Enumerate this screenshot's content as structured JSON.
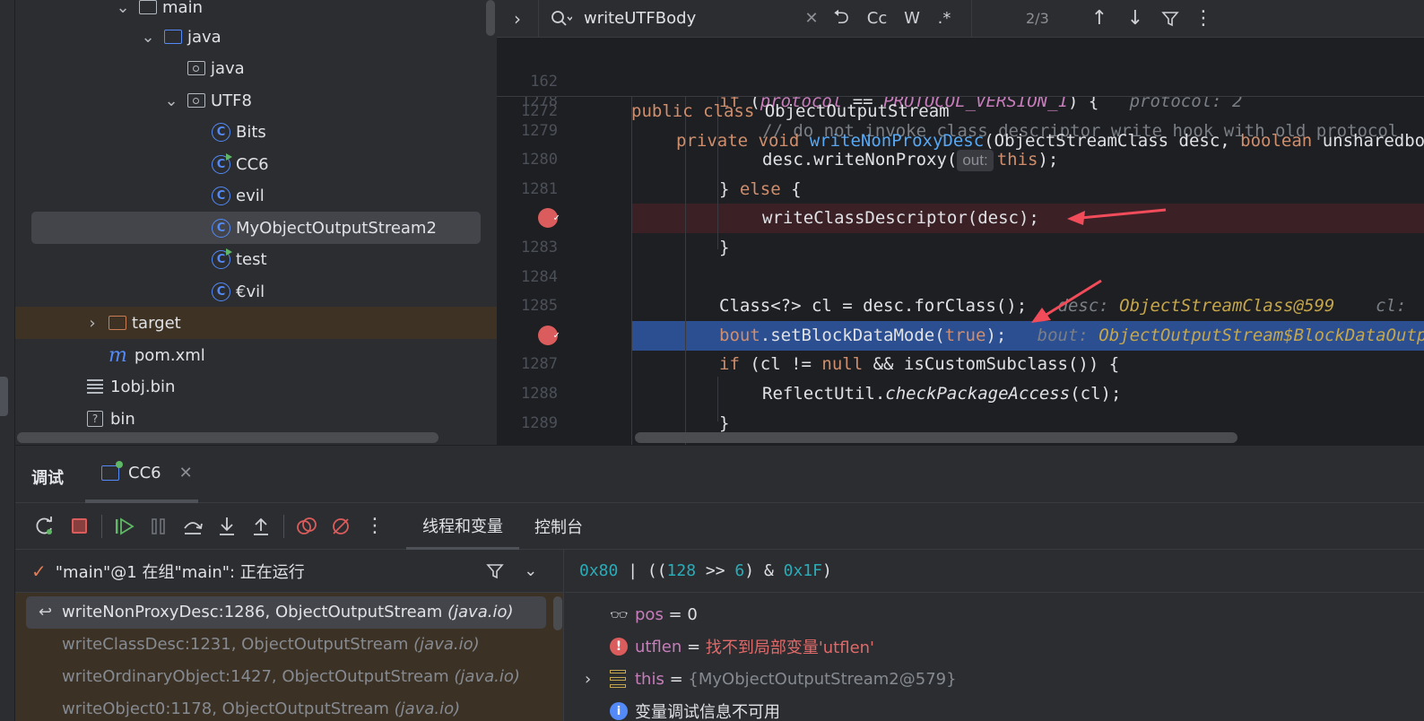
{
  "project_tree": {
    "items": [
      {
        "label": "main",
        "depth": 6,
        "expanded": true,
        "icon": "folder-icon"
      },
      {
        "label": "java",
        "depth": 7,
        "expanded": true,
        "icon": "source-folder-icon"
      },
      {
        "label": "java",
        "depth": 8,
        "icon": "package-icon"
      },
      {
        "label": "UTF8",
        "depth": 8,
        "expanded": true,
        "icon": "package-icon"
      },
      {
        "label": "Bits",
        "depth": 9,
        "icon": "class-icon"
      },
      {
        "label": "CC6",
        "depth": 9,
        "icon": "runnable-class-icon"
      },
      {
        "label": "evil",
        "depth": 9,
        "icon": "class-icon"
      },
      {
        "label": "MyObjectOutputStream2",
        "depth": 9,
        "icon": "class-icon",
        "selected": true
      },
      {
        "label": "test",
        "depth": 9,
        "icon": "runnable-class-icon"
      },
      {
        "label": "€vil",
        "depth": 9,
        "icon": "class-icon"
      },
      {
        "label": "target",
        "depth": 5,
        "expanded": false,
        "icon": "excluded-folder-icon"
      },
      {
        "label": "pom.xml",
        "depth": 5,
        "icon": "maven-icon"
      },
      {
        "label": "1obj.bin",
        "depth": 4,
        "icon": "text-file-icon"
      },
      {
        "label": "bin",
        "depth": 4,
        "icon": "unknown-file-icon"
      }
    ]
  },
  "find_bar": {
    "query": "writeUTFBody",
    "match_case": "Cc",
    "words": "W",
    "regex": ".*",
    "match_count": "2/3"
  },
  "editor": {
    "sticky": [
      {
        "line": "162",
        "segments": [
          [
            "kw",
            "public class "
          ],
          [
            "",
            "ObjectOutputStream"
          ]
        ]
      },
      {
        "line": "1272",
        "segments": [
          [
            "kw",
            "private void "
          ],
          [
            "fn",
            "writeNonProxyDesc"
          ],
          [
            "",
            "(ObjectStreamClass desc, "
          ],
          [
            "kw",
            "boolean "
          ],
          [
            "",
            "unsharedboolean unshared"
          ]
        ]
      }
    ],
    "lines": [
      {
        "line": "1278",
        "segments": [
          [
            "kw",
            "if "
          ],
          [
            "",
            "("
          ],
          [
            "const",
            "protocol"
          ],
          [
            "",
            " == "
          ],
          [
            "const",
            "PROTOCOL_VERSION_1"
          ],
          [
            "",
            ") {   "
          ],
          [
            "hint",
            "protocol: 2"
          ]
        ]
      },
      {
        "line": "1279",
        "segments": [
          [
            "cm",
            "// do not invoke class descriptor write hook with old protocol"
          ]
        ]
      },
      {
        "line": "1280",
        "segments": [
          [
            "",
            "desc.writeNonProxy("
          ],
          [
            "chip",
            "out:"
          ],
          [
            "kw",
            "this"
          ],
          [
            "",
            ");"
          ]
        ]
      },
      {
        "line": "1281",
        "segments": [
          [
            "",
            "} "
          ],
          [
            "kw",
            "else "
          ],
          [
            "",
            "{"
          ]
        ]
      },
      {
        "line": "",
        "segments": [
          [
            "",
            "writeClassDescriptor(desc);"
          ]
        ],
        "breakpoint": true
      },
      {
        "line": "1283",
        "segments": [
          [
            "",
            "}"
          ]
        ]
      },
      {
        "line": "1284",
        "segments": []
      },
      {
        "line": "1285",
        "segments": [
          [
            "",
            "Class<?> cl = desc.forClass();   "
          ],
          [
            "hint",
            "desc: "
          ],
          [
            "inl",
            "ObjectStreamClass@599"
          ],
          [
            "hint",
            "    cl: "
          ]
        ]
      },
      {
        "line": "",
        "segments": [
          [
            "kw",
            "bout"
          ],
          [
            "",
            ".setBlockDataMode("
          ],
          [
            "kw",
            "true"
          ],
          [
            "",
            ");   "
          ],
          [
            "hint",
            "bout: "
          ],
          [
            "inl",
            "ObjectOutputStream$BlockDataOutputStream"
          ]
        ],
        "breakpoint": true,
        "current": true
      },
      {
        "line": "1287",
        "segments": [
          [
            "kw",
            "if "
          ],
          [
            "",
            "(cl != "
          ],
          [
            "kw",
            "null "
          ],
          [
            "",
            "&& isCustomSubclass()) {"
          ]
        ]
      },
      {
        "line": "1288",
        "segments": [
          [
            "",
            "ReflectUtil."
          ],
          [
            "it",
            "checkPackageAccess"
          ],
          [
            "",
            "(cl);"
          ]
        ]
      },
      {
        "line": "1289",
        "segments": [
          [
            "",
            "}"
          ]
        ]
      }
    ]
  },
  "debug": {
    "tab_title": "调试",
    "session_tab": "CC6",
    "view_tabs": [
      "线程和变量",
      "控制台"
    ],
    "thread_status": "\"main\"@1 在组\"main\": 正在运行",
    "frames": [
      {
        "method": "writeNonProxyDesc:1286, ObjectOutputStream",
        "pkg": "(java.io)",
        "current": true
      },
      {
        "method": "writeClassDesc:1231, ObjectOutputStream",
        "pkg": "(java.io)"
      },
      {
        "method": "writeOrdinaryObject:1427, ObjectOutputStream",
        "pkg": "(java.io)"
      },
      {
        "method": "writeObject0:1178, ObjectOutputStream",
        "pkg": "(java.io)"
      }
    ],
    "evaluate_expr": "0x80 | ((128 >> 6) & 0x1F)",
    "variables": [
      {
        "icon": "watch-icon",
        "name": "pos",
        "eq": " = ",
        "value": "0",
        "kind": "normal"
      },
      {
        "icon": "error-icon",
        "name": "utflen",
        "eq": " = ",
        "value": "找不到局部变量'utflen'",
        "kind": "error"
      },
      {
        "icon": "object-icon",
        "name": "this",
        "eq": " = ",
        "value": "{MyObjectOutputStream2@579}",
        "kind": "object",
        "expandable": true
      },
      {
        "icon": "info-icon",
        "name": "变量调试信息不可用",
        "eq": "",
        "value": "",
        "kind": "info"
      }
    ]
  },
  "colors": {
    "accent": "#548af7",
    "breakpoint": "#db5c5c",
    "current_line": "#2c4f92",
    "error": "#e06a6a"
  }
}
